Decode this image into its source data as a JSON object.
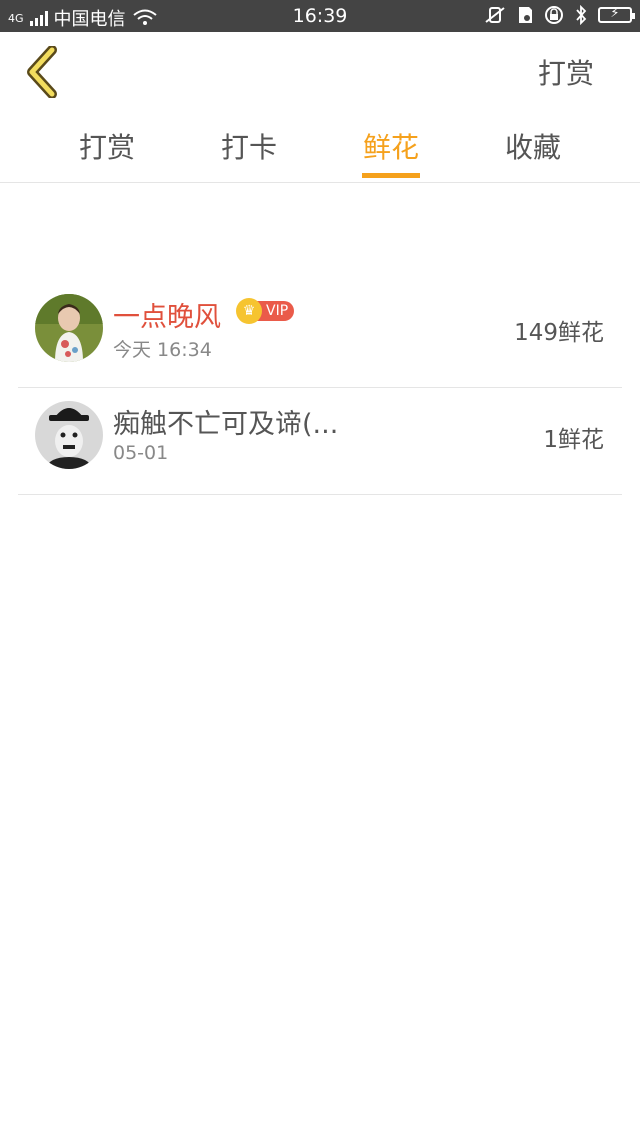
{
  "status_bar": {
    "network": "4G",
    "carrier": "中国电信",
    "time": "16:39"
  },
  "header": {
    "back_icon": "chevron-left-icon",
    "action_label": "打赏"
  },
  "tabs": [
    {
      "label": "打赏",
      "active": false
    },
    {
      "label": "打卡",
      "active": false
    },
    {
      "label": "鲜花",
      "active": true
    },
    {
      "label": "收藏",
      "active": false
    }
  ],
  "list": [
    {
      "name": "一点晚风",
      "is_vip": true,
      "vip_label": "VIP",
      "time": "今天 16:34",
      "count": "149鲜花",
      "name_color": "#e0503c"
    },
    {
      "name": "痴触不亡可及谛(...",
      "is_vip": false,
      "time": "05-01",
      "count": "1鲜花",
      "name_color": "#555555"
    }
  ],
  "colors": {
    "accent": "#f5a11c",
    "vip_red": "#ea5b4a",
    "vip_gold": "#f6c430"
  }
}
